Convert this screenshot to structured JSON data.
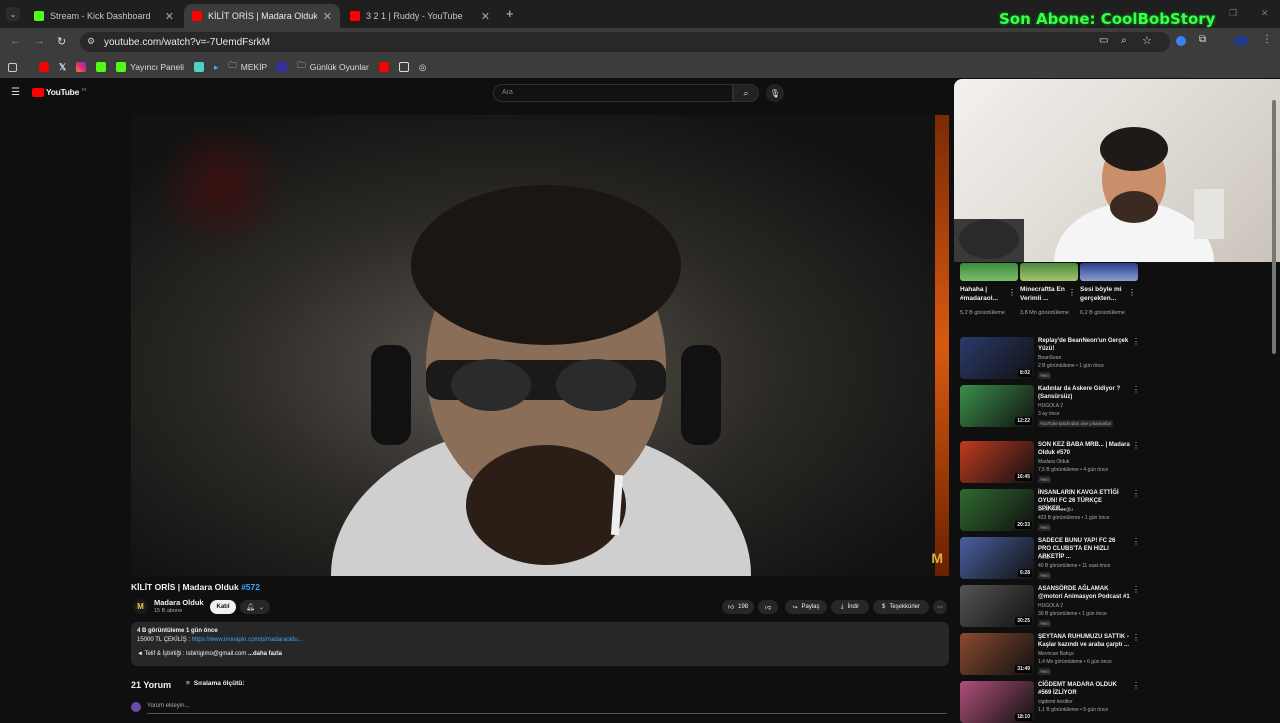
{
  "tabs": [
    {
      "title": "Stream - Kick Dashboard",
      "icon": "kick-icon",
      "color": "#53fc18"
    },
    {
      "title": "KİLİT ORİS | Madara Olduk #572",
      "icon": "youtube-icon",
      "color": "#ff0000"
    },
    {
      "title": "3 2 1 | Ruddy - YouTube",
      "icon": "youtube-icon",
      "color": "#ff0000"
    }
  ],
  "url": "youtube.com/watch?v=-7UemdFsrkM",
  "bookmarks": [
    "Yayıncı Paneli",
    "MEKİP",
    "Günlük Oyunlar"
  ],
  "overlay": {
    "text": "Son Abone: CoolBobStory"
  },
  "youtube": {
    "search_placeholder": "Ara",
    "logo": "YouTube",
    "logo_suffix": "TR"
  },
  "video": {
    "title": "KİLİT ORİS | Madara Olduk ",
    "title_tag": "#572",
    "watermark": "M",
    "channel_initials": "M",
    "channel": "Madara Olduk",
    "subs": "15 B abone",
    "join": "Katıl",
    "likes": "198",
    "share": "Paylaş",
    "download": "İndir",
    "thanks": "Teşekkürler",
    "desc_stats": "4 B görüntüleme  1 gün önce",
    "desc_line2_a": "15000 TL ÇEKİLİŞ : ",
    "desc_line2_link": "https://www.inovapin.com/p/madaraoldu...",
    "desc_line3": "◄ Telif & İşbirliği : isbirligimo@gmail.com ",
    "desc_more": "...daha fazla",
    "comments_count": "21 Yorum",
    "sort": "Sıralama ölçütü:",
    "add_comment": "Yorum ekleyin..."
  },
  "shorts": [
    {
      "title": "Hahaha | #madaraol...",
      "views": "5,2 B görüntüleme"
    },
    {
      "title": "Minecraftta En Verimli ...",
      "views": "3,8 Mn görüntüleme"
    },
    {
      "title": "Sesi böyle mi gerçekten...",
      "views": "6,2 B görüntüleme"
    }
  ],
  "recommendations": [
    {
      "title": "Replay'de BeanNeon'un Gerçek Yüzü!",
      "channel": "BeanSean",
      "views": "2 B görüntüleme • 1 gün önce",
      "badge": "Yeni",
      "duration": "8:02",
      "color": "#2b3a6b"
    },
    {
      "title": "Kadınlar da Askere Gidiyor ? (Sansürsüz)",
      "channel": "HUGOLA 2",
      "views": "3 ay önce",
      "badge": "YouTube tarafından öne çıkarılanlar",
      "duration": "12:22",
      "color": "#3a8f4a"
    },
    {
      "title": "SON KEZ BABA MRB... | Madara Olduk #570",
      "channel": "Madara Olduk",
      "views": "7,5 B görüntüleme • 4 gün önce",
      "badge": "Yeni",
      "duration": "16:45",
      "color": "#c03a20"
    },
    {
      "title": "İNSANLARIN KAVGA ETTİĞİ OYUN! FC 26 TÜRKÇE SPİKER...",
      "channel": "Emin Kırkızoğlu",
      "views": "433 B görüntüleme • 1 gün önce",
      "badge": "Yeni",
      "duration": "20:33",
      "color": "#2f6a2f"
    },
    {
      "title": "SADECE BUNU YAP! FC 26 PRO CLUBS'TA EN HIZLI ARKETİP ...",
      "channel": "Heisi",
      "views": "40 B görüntüleme • 11 saat önce",
      "badge": "Yeni",
      "duration": "6:28",
      "color": "#4a60a0"
    },
    {
      "title": "ASANSÖRDE AĞLAMAK @motori Animasyon Podcast #1",
      "channel": "HUGOLA 2",
      "views": "30 B görüntüleme • 1 gün önce",
      "badge": "Yeni",
      "duration": "30:25",
      "color": "#555555"
    },
    {
      "title": "ŞEYTANA RUHUMUZU SATTIK - Kaşlar kazındı ve araba çarptı ...",
      "channel": "Mevrican Bahçe",
      "views": "1,4 Mn görüntüleme • 6 gün önce",
      "badge": "Yeni",
      "duration": "31:49",
      "color": "#8a4a30"
    },
    {
      "title": "CİĞDEMT MADARA OLDUK #569 İZLİYOR",
      "channel": "cigdemt kesitler",
      "views": "1,1 B görüntüleme • 5 gün önce",
      "badge": "",
      "duration": "18:10",
      "color": "#b0507a"
    }
  ]
}
